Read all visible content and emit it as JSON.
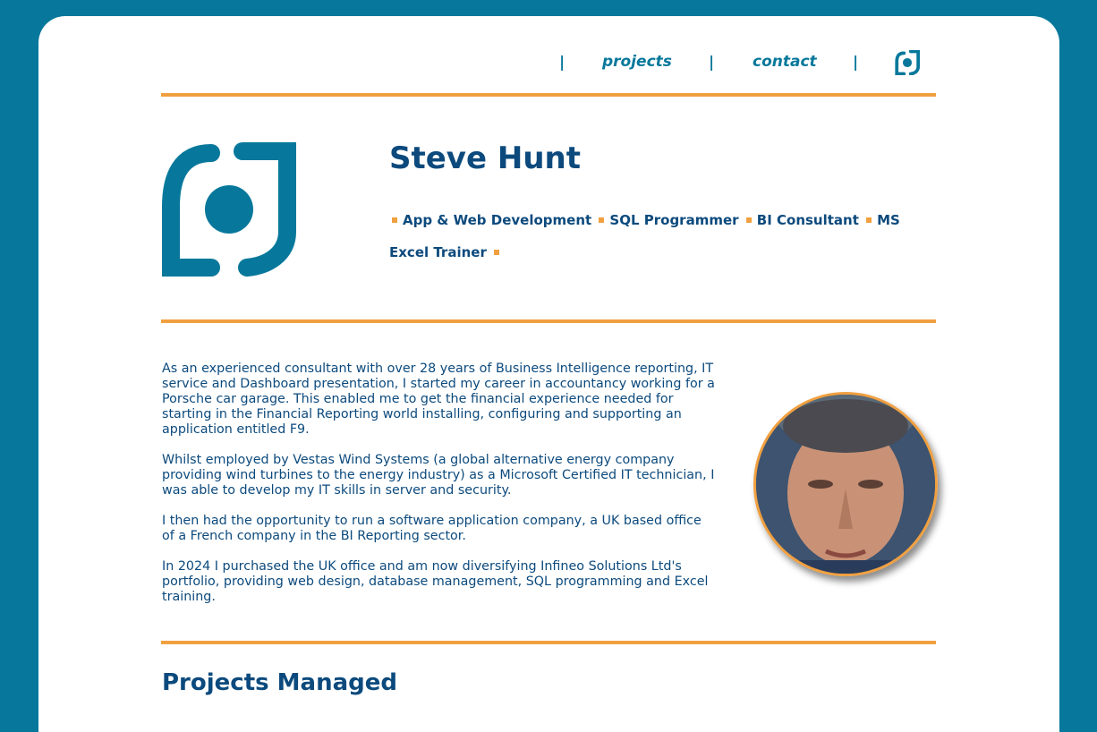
{
  "nav": {
    "separator": "|",
    "projects_label": "projects",
    "contact_label": "contact",
    "logo_icon": "infineo-logo-icon"
  },
  "header": {
    "name": "Steve Hunt",
    "skills": [
      "App & Web Development",
      "SQL Programmer",
      "BI Consultant",
      "MS Excel Trainer"
    ]
  },
  "bio": {
    "paragraphs": [
      "As an experienced consultant with over 28 years of Business Intelligence reporting, IT service and Dashboard presentation, I started my career in accountancy working for a Porsche car garage. This enabled me to get the financial experience needed for starting in the Financial Reporting world installing, configuring and supporting an application entitled F9.",
      "Whilst employed by Vestas Wind Systems (a global alternative energy company providing wind turbines to the energy industry) as a Microsoft Certified IT technician, I was able to develop my IT skills in server and security.",
      "I then had the opportunity to run a software application company, a UK based office of a French company in the BI Reporting sector.",
      "In 2024 I purchased the UK office and am now diversifying Infineo Solutions Ltd's portfolio, providing web design, database management, SQL programming and Excel training."
    ]
  },
  "sections": {
    "projects_title": "Projects Managed"
  },
  "colors": {
    "background": "#07789b",
    "accent": "#f0a040",
    "text": "#0c4a7d"
  }
}
